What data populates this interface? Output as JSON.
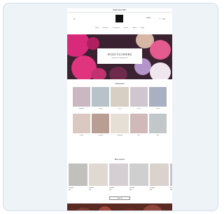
{
  "announcement": "FREE DELIVERY",
  "header": {
    "account_label": "Log in",
    "icons": [
      "search-icon",
      "user-icon",
      "cart-icon"
    ]
  },
  "nav": [
    "Shop",
    "Flowers",
    "Occasions",
    "Events",
    "About",
    "Blog"
  ],
  "hero": {
    "title": "WILD FLOWERS",
    "subtitle": "Seasonal arrangements"
  },
  "categories": {
    "title": "Categories",
    "items": [
      {
        "label": "Bouquets",
        "color": "#c9b8c2"
      },
      {
        "label": "Boxes",
        "color": "#b7c2c9"
      },
      {
        "label": "Dried",
        "color": "#d7cfc4"
      },
      {
        "label": "Plants",
        "color": "#cfc6cf"
      },
      {
        "label": "Vases",
        "color": "#a9b0c2"
      },
      {
        "label": "Roses",
        "color": "#d9c9c0"
      },
      {
        "label": "Peonies",
        "color": "#b99f93"
      },
      {
        "label": "Wedding",
        "color": "#e6dfd5"
      },
      {
        "label": "Gifts",
        "color": "#d0b9b8"
      },
      {
        "label": "Sale",
        "color": "#c2c8c9"
      }
    ]
  },
  "products": {
    "title": "Best sellers",
    "items": [
      {
        "name": "Bouquet",
        "price": "£45",
        "color": "#c2c0bc"
      },
      {
        "name": "Bouquet",
        "price": "£55",
        "color": "#dfd9d2"
      },
      {
        "name": "Bouquet",
        "price": "£40",
        "color": "#d5cfd4"
      },
      {
        "name": "Bouquet",
        "price": "£60",
        "color": "#cfcfcf"
      },
      {
        "name": "Bouquet",
        "price": "£50",
        "color": "#d9d2cd"
      },
      {
        "name": "Bouquet",
        "price": "£35",
        "color": "#c7c4c9"
      }
    ],
    "view_all": "View all"
  }
}
